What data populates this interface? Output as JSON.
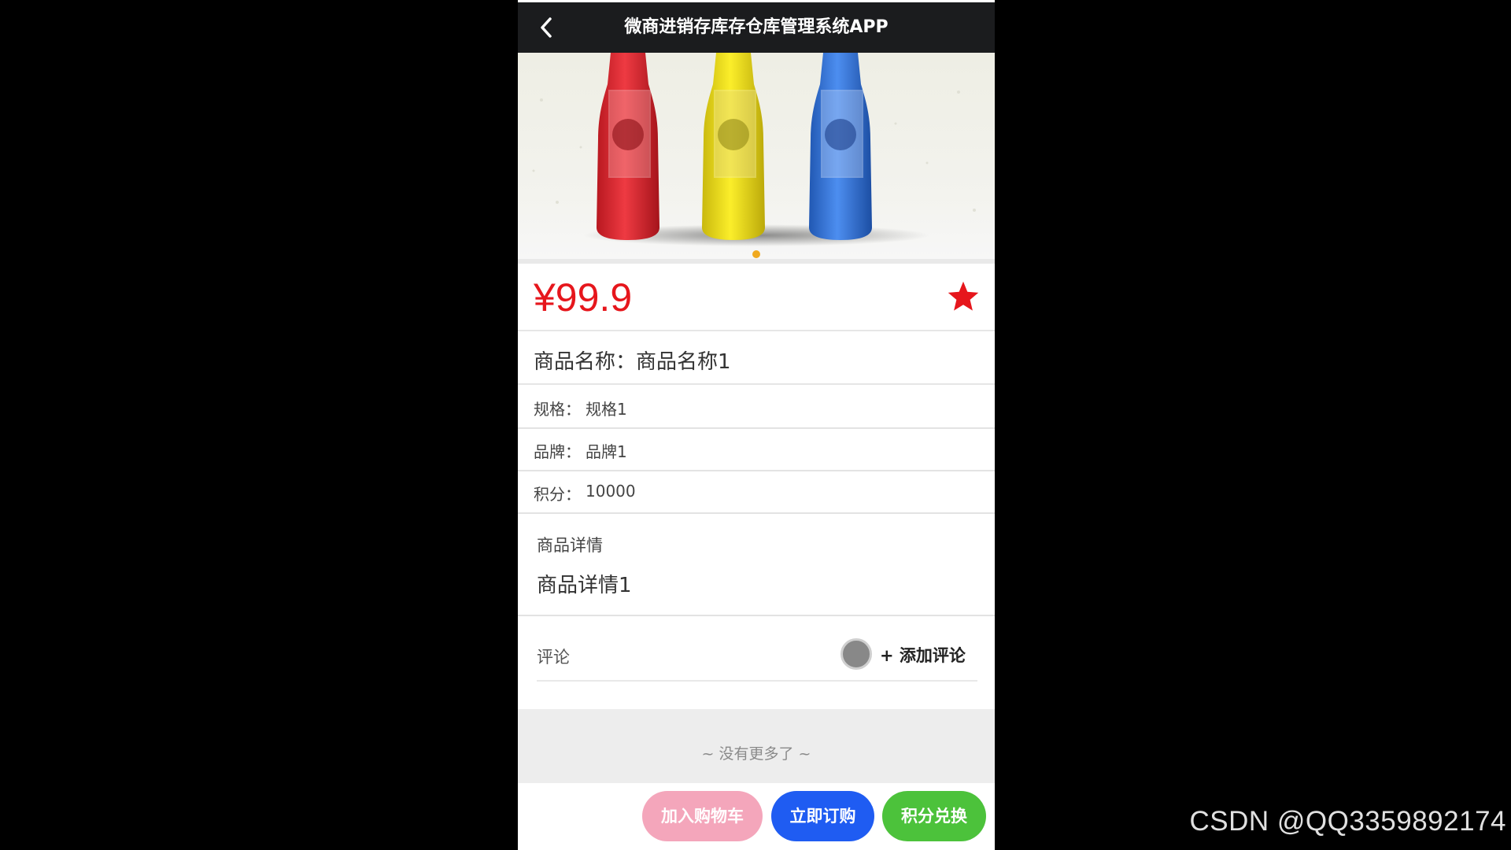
{
  "header": {
    "title": "微商进销存库存仓库管理系统APP",
    "back_icon": "chevron-left-icon"
  },
  "banner": {
    "image": "three-bottles-product-photo",
    "bottle_colors": [
      "#e8303a",
      "#f5e51b",
      "#3b7ee0"
    ],
    "active_dot_color": "#f0a91f"
  },
  "product": {
    "price": "¥99.9",
    "favorite_icon": "star-icon",
    "favorite_color": "#e6161c",
    "name_label": "商品名称：",
    "name_value": "商品名称1",
    "spec_label": "规格：",
    "spec_value": "规格1",
    "brand_label": "品牌：",
    "brand_value": "品牌1",
    "points_label": "积分：",
    "points_value": "10000",
    "detail_heading": "商品详情",
    "detail_content": "商品详情1"
  },
  "comments": {
    "label": "评论",
    "add_label": "+ 添加评论",
    "no_more": "~ 没有更多了 ~"
  },
  "actions": {
    "add_to_cart": "加入购物车",
    "buy_now": "立即订购",
    "points_exchange": "积分兑换"
  },
  "watermark": "CSDN @QQ3359892174"
}
